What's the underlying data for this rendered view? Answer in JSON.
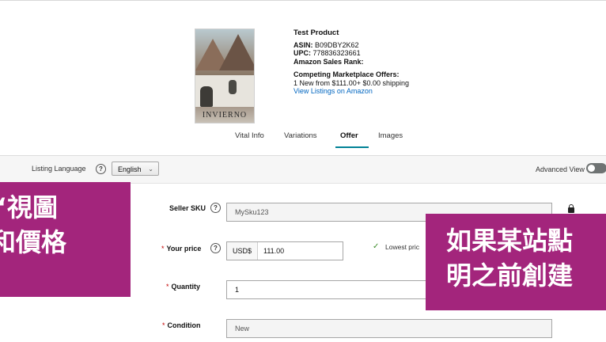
{
  "product": {
    "image_caption": "INVIERNO",
    "title": "Test Product",
    "asin_label": "ASIN:",
    "asin": "B09DBY2K62",
    "upc_label": "UPC:",
    "upc": "778836323661",
    "sales_rank_label": "Amazon Sales Rank:",
    "offers_heading": "Competing Marketplace Offers:",
    "offers_text": "1 New  from $111.00+ $0.00 shipping",
    "view_listings": "View Listings on Amazon"
  },
  "tabs": [
    {
      "label": "Vital Info",
      "active": false
    },
    {
      "label": "Variations",
      "active": false
    },
    {
      "label": "Offer",
      "active": true
    },
    {
      "label": "Images",
      "active": false
    }
  ],
  "settings": {
    "listing_language_label": "Listing Language",
    "language_value": "English",
    "advanced_view_label": "Advanced View",
    "help_icon_glyph": "?",
    "advanced_view_on": false
  },
  "form": {
    "seller_sku_label": "Seller SKU",
    "seller_sku_value": "MySku123",
    "your_price_label": "Your price",
    "currency": "USD$",
    "price_value": "111.00",
    "lowest_price_text": "Lowest pric",
    "quantity_label": "Quantity",
    "quantity_value": "1",
    "condition_label": "Condition",
    "condition_value": "New",
    "required_mark": "*"
  },
  "overlays": {
    "left_lines": [
      "“視圖",
      "和價格"
    ],
    "right_lines": [
      "如果某站點",
      "明之前創建"
    ]
  },
  "colors": {
    "accent_tab": "#008296",
    "link": "#0066c0",
    "overlay": "#a3257c",
    "required": "#c40000",
    "check": "#3c8c2a"
  }
}
